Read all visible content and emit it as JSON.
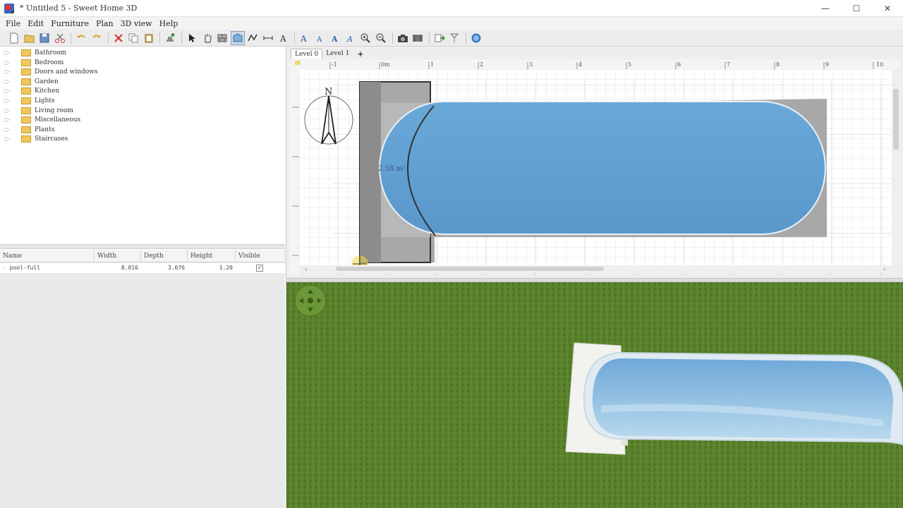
{
  "window": {
    "title": "* Untitled 5 - Sweet Home 3D",
    "controls": [
      "—",
      "☐",
      "✕"
    ]
  },
  "menu": [
    "File",
    "Edit",
    "Furniture",
    "Plan",
    "3D view",
    "Help"
  ],
  "toolbar": {
    "icons": [
      "new-icon",
      "open-icon",
      "save-icon",
      "cut-icon",
      "copy-icon",
      "paste-icon",
      "undo-icon",
      "redo-icon",
      "delete-icon",
      "add-furniture-icon",
      "select-icon",
      "pan-icon",
      "create-walls-icon",
      "create-rooms-icon",
      "create-dimensions-icon",
      "create-labels-icon",
      "text-style-icon",
      "zoom-in-icon",
      "zoom-out-icon",
      "create-photo-icon",
      "create-video-icon",
      "import-furniture-icon",
      "import-background-icon",
      "help-icon"
    ]
  },
  "catalog": {
    "categories": [
      "Bathroom",
      "Bedroom",
      "Doors and windows",
      "Garden",
      "Kitchen",
      "Lights",
      "Living room",
      "Miscellaneous",
      "Plants",
      "Staircases"
    ]
  },
  "furniture_table": {
    "columns": [
      "Name",
      "Width",
      "Depth",
      "Height",
      "Visible"
    ],
    "rows": [
      {
        "name": "pool-full",
        "width": "8.016",
        "depth": "3.076",
        "height": "1.20",
        "visible": true
      }
    ]
  },
  "plan": {
    "levels": [
      "Level 0",
      "Level 1"
    ],
    "add_level_label": "+",
    "ruler_labels": [
      "-1",
      "0m",
      "1",
      "2",
      "3",
      "4",
      "5",
      "6",
      "7",
      "8",
      "9",
      "10"
    ],
    "compass_label": "N",
    "area_label": "2.58 m²",
    "colors": {
      "grid_bg": "#ffffff",
      "grid_line": "#d6d6d6",
      "pool_water": "#5f9fd2",
      "deck": "#a8a8a8",
      "wall_dark": "#8c8c8c"
    }
  },
  "view3d": {
    "navigator_icon": "navigation-arrows-icon",
    "colors": {
      "grass": "#5a7f2e",
      "pool_water": "#9ec8e6",
      "deck": "#f2f2ee"
    }
  }
}
